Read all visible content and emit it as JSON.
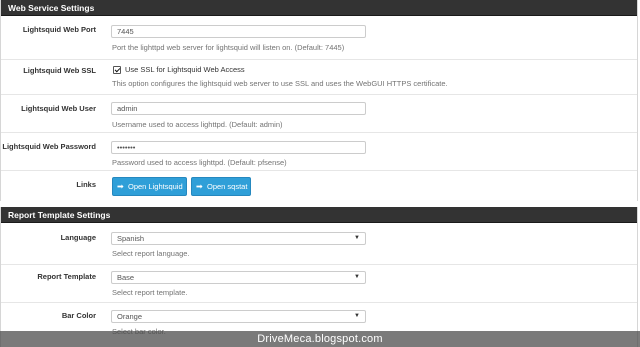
{
  "web_service": {
    "heading": "Web Service Settings",
    "port": {
      "label": "Lightsquid Web Port",
      "value": "7445",
      "help": "Port the lighttpd web server for lightsquid will listen on. (Default: 7445)"
    },
    "ssl": {
      "label": "Lightsquid Web SSL",
      "checkbox_label": "Use SSL for Lightsquid Web Access",
      "checked": true,
      "help": "This option configures the lightsquid web server to use SSL and uses the WebGUI HTTPS certificate."
    },
    "user": {
      "label": "Lightsquid Web User",
      "value": "admin",
      "help": "Username used to access lighttpd. (Default: admin)"
    },
    "password": {
      "label": "Lightsquid Web Password",
      "value": "•••••••",
      "help": "Password used to access lighttpd. (Default: pfsense)"
    },
    "links": {
      "label": "Links",
      "open_lightsquid": "Open Lightsquid",
      "open_sqstat": "Open sqstat"
    }
  },
  "report_template": {
    "heading": "Report Template Settings",
    "language": {
      "label": "Language",
      "value": "Spanish",
      "help": "Select report language."
    },
    "template": {
      "label": "Report Template",
      "value": "Base",
      "help": "Select report template."
    },
    "bar_color": {
      "label": "Bar Color",
      "value": "Orange",
      "help": "Select bar color."
    }
  },
  "watermark": "DriveMeca.blogspot.com",
  "colors": {
    "heading_bg": "#333333",
    "button_bg": "#2f9fd8",
    "help_text": "#737373"
  },
  "icons": {
    "button": "sign-in-icon",
    "select": "caret-down-icon"
  }
}
